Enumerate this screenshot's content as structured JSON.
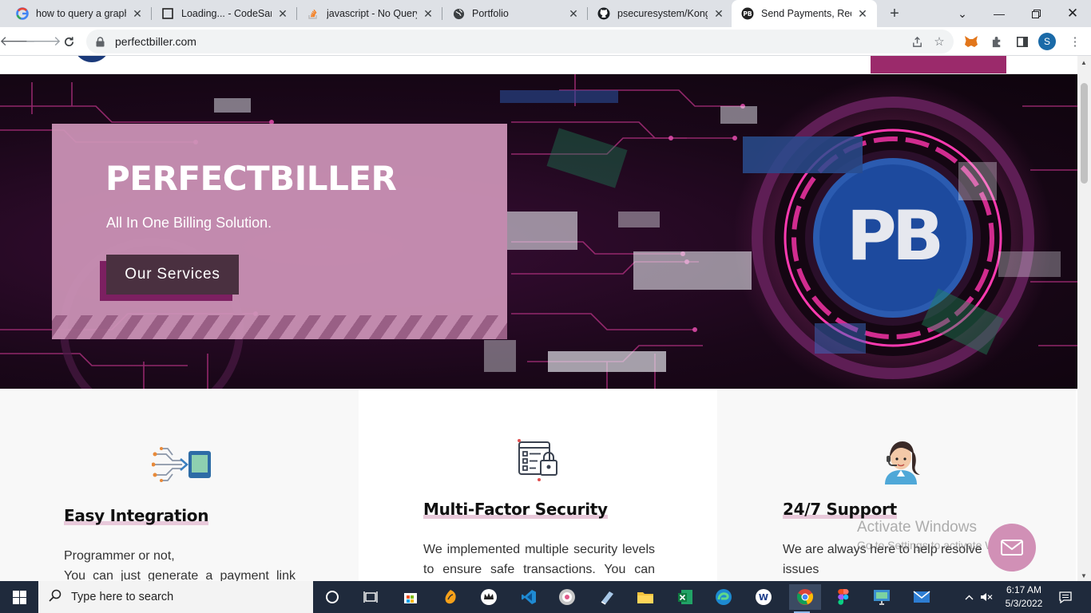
{
  "browser": {
    "tabs": [
      {
        "title": "how to query a graphq",
        "icon": "google-icon"
      },
      {
        "title": "Loading... - CodeSand",
        "icon": "codesandbox-icon"
      },
      {
        "title": "javascript - No QueryC",
        "icon": "stackoverflow-icon"
      },
      {
        "title": "Portfolio",
        "icon": "globe-icon"
      },
      {
        "title": "psecuresystem/Konga",
        "icon": "github-icon"
      },
      {
        "title": "Send Payments, Receiv",
        "icon": "pb-icon",
        "active": true
      }
    ],
    "url": "perfectbiller.com",
    "profile_initial": "S"
  },
  "hero": {
    "title": "PERFECTBILLER",
    "subtitle": "All In One Billing Solution.",
    "cta_label": "Our Services",
    "logo_text": "PB"
  },
  "features": [
    {
      "icon": "integration-icon",
      "title": "Easy Integration",
      "text_line1": "Programmer or not,",
      "text_line2": "You can just generate a payment link"
    },
    {
      "icon": "security-lock-icon",
      "title": "Multi-Factor Security",
      "text_line1": "We implemented multiple security levels",
      "text_line2": "to ensure safe transactions. You can"
    },
    {
      "icon": "support-agent-icon",
      "title": "24/7 Support",
      "text_line1": "We are always here to help resolve your",
      "text_line2": "issues"
    }
  ],
  "watermark": {
    "line1": "Activate Windows",
    "line2": "Go to Settings to activate Windows."
  },
  "taskbar": {
    "search_placeholder": "Type here to search",
    "time": "6:17 AM",
    "date": "5/3/2022"
  },
  "colors": {
    "brand_pink": "#cd94b8",
    "brand_dark": "#4a3040",
    "brand_magenta": "#9b2a6b",
    "hero_bg": "#1a0719"
  }
}
